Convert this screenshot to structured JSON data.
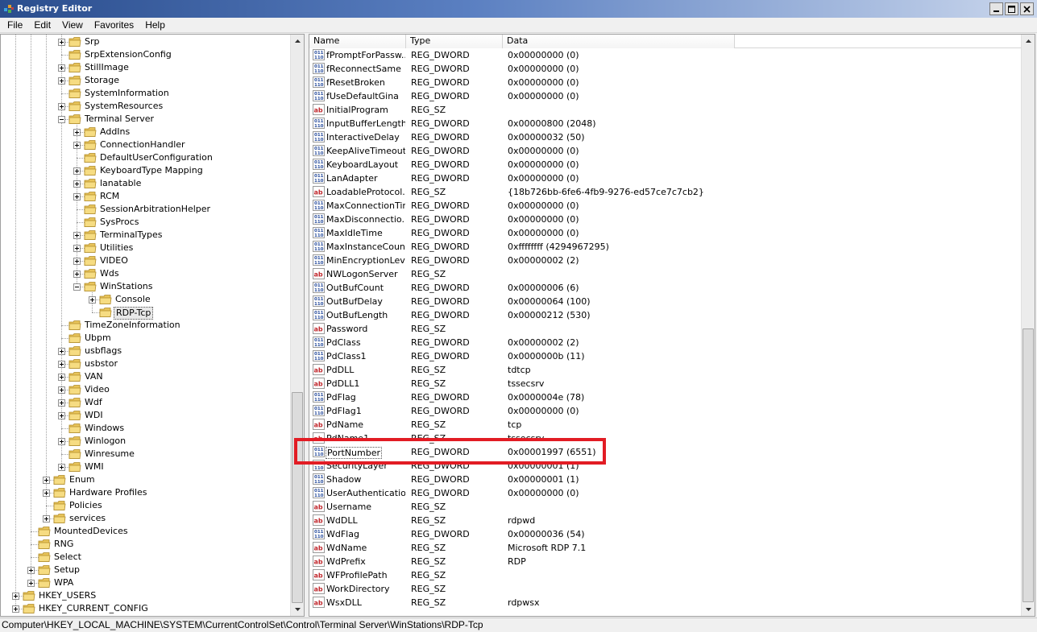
{
  "window": {
    "title": "Registry Editor"
  },
  "menu": [
    "File",
    "Edit",
    "View",
    "Favorites",
    "Help"
  ],
  "tree": [
    {
      "label": "Srp",
      "level": 3,
      "expandable": true
    },
    {
      "label": "SrpExtensionConfig",
      "level": 3,
      "expandable": false
    },
    {
      "label": "StillImage",
      "level": 3,
      "expandable": true
    },
    {
      "label": "Storage",
      "level": 3,
      "expandable": true
    },
    {
      "label": "SystemInformation",
      "level": 3,
      "expandable": false
    },
    {
      "label": "SystemResources",
      "level": 3,
      "expandable": true
    },
    {
      "label": "Terminal Server",
      "level": 3,
      "expandable": true,
      "expanded": true
    },
    {
      "label": "AddIns",
      "level": 4,
      "expandable": true
    },
    {
      "label": "ConnectionHandler",
      "level": 4,
      "expandable": true
    },
    {
      "label": "DefaultUserConfiguration",
      "level": 4,
      "expandable": false
    },
    {
      "label": "KeyboardType Mapping",
      "level": 4,
      "expandable": true
    },
    {
      "label": "lanatable",
      "level": 4,
      "expandable": true
    },
    {
      "label": "RCM",
      "level": 4,
      "expandable": true
    },
    {
      "label": "SessionArbitrationHelper",
      "level": 4,
      "expandable": false
    },
    {
      "label": "SysProcs",
      "level": 4,
      "expandable": false
    },
    {
      "label": "TerminalTypes",
      "level": 4,
      "expandable": true
    },
    {
      "label": "Utilities",
      "level": 4,
      "expandable": true
    },
    {
      "label": "VIDEO",
      "level": 4,
      "expandable": true
    },
    {
      "label": "Wds",
      "level": 4,
      "expandable": true
    },
    {
      "label": "WinStations",
      "level": 4,
      "expandable": true,
      "expanded": true
    },
    {
      "label": "Console",
      "level": 5,
      "expandable": true
    },
    {
      "label": "RDP-Tcp",
      "level": 5,
      "expandable": false,
      "selected": true
    },
    {
      "label": "TimeZoneInformation",
      "level": 3,
      "expandable": false
    },
    {
      "label": "Ubpm",
      "level": 3,
      "expandable": false
    },
    {
      "label": "usbflags",
      "level": 3,
      "expandable": true
    },
    {
      "label": "usbstor",
      "level": 3,
      "expandable": true
    },
    {
      "label": "VAN",
      "level": 3,
      "expandable": true
    },
    {
      "label": "Video",
      "level": 3,
      "expandable": true
    },
    {
      "label": "Wdf",
      "level": 3,
      "expandable": true
    },
    {
      "label": "WDI",
      "level": 3,
      "expandable": true
    },
    {
      "label": "Windows",
      "level": 3,
      "expandable": false
    },
    {
      "label": "Winlogon",
      "level": 3,
      "expandable": true
    },
    {
      "label": "Winresume",
      "level": 3,
      "expandable": false
    },
    {
      "label": "WMI",
      "level": 3,
      "expandable": true
    },
    {
      "label": "Enum",
      "level": 2,
      "expandable": true
    },
    {
      "label": "Hardware Profiles",
      "level": 2,
      "expandable": true
    },
    {
      "label": "Policies",
      "level": 2,
      "expandable": false
    },
    {
      "label": "services",
      "level": 2,
      "expandable": true
    },
    {
      "label": "MountedDevices",
      "level": 1,
      "expandable": false
    },
    {
      "label": "RNG",
      "level": 1,
      "expandable": false
    },
    {
      "label": "Select",
      "level": 1,
      "expandable": false
    },
    {
      "label": "Setup",
      "level": 1,
      "expandable": true
    },
    {
      "label": "WPA",
      "level": 1,
      "expandable": true
    },
    {
      "label": "HKEY_USERS",
      "level": 0,
      "expandable": true
    },
    {
      "label": "HKEY_CURRENT_CONFIG",
      "level": 0,
      "expandable": true
    }
  ],
  "list": {
    "columns": [
      "Name",
      "Type",
      "Data"
    ],
    "rows": [
      {
        "name": "fPromptForPassw...",
        "type": "REG_DWORD",
        "data": "0x00000000 (0)"
      },
      {
        "name": "fReconnectSame",
        "type": "REG_DWORD",
        "data": "0x00000000 (0)"
      },
      {
        "name": "fResetBroken",
        "type": "REG_DWORD",
        "data": "0x00000000 (0)"
      },
      {
        "name": "fUseDefaultGina",
        "type": "REG_DWORD",
        "data": "0x00000000 (0)"
      },
      {
        "name": "InitialProgram",
        "type": "REG_SZ",
        "data": ""
      },
      {
        "name": "InputBufferLength",
        "type": "REG_DWORD",
        "data": "0x00000800 (2048)"
      },
      {
        "name": "InteractiveDelay",
        "type": "REG_DWORD",
        "data": "0x00000032 (50)"
      },
      {
        "name": "KeepAliveTimeout",
        "type": "REG_DWORD",
        "data": "0x00000000 (0)"
      },
      {
        "name": "KeyboardLayout",
        "type": "REG_DWORD",
        "data": "0x00000000 (0)"
      },
      {
        "name": "LanAdapter",
        "type": "REG_DWORD",
        "data": "0x00000000 (0)"
      },
      {
        "name": "LoadableProtocol...",
        "type": "REG_SZ",
        "data": "{18b726bb-6fe6-4fb9-9276-ed57ce7c7cb2}"
      },
      {
        "name": "MaxConnectionTime",
        "type": "REG_DWORD",
        "data": "0x00000000 (0)"
      },
      {
        "name": "MaxDisconnectio...",
        "type": "REG_DWORD",
        "data": "0x00000000 (0)"
      },
      {
        "name": "MaxIdleTime",
        "type": "REG_DWORD",
        "data": "0x00000000 (0)"
      },
      {
        "name": "MaxInstanceCount",
        "type": "REG_DWORD",
        "data": "0xffffffff (4294967295)"
      },
      {
        "name": "MinEncryptionLevel",
        "type": "REG_DWORD",
        "data": "0x00000002 (2)"
      },
      {
        "name": "NWLogonServer",
        "type": "REG_SZ",
        "data": ""
      },
      {
        "name": "OutBufCount",
        "type": "REG_DWORD",
        "data": "0x00000006 (6)"
      },
      {
        "name": "OutBufDelay",
        "type": "REG_DWORD",
        "data": "0x00000064 (100)"
      },
      {
        "name": "OutBufLength",
        "type": "REG_DWORD",
        "data": "0x00000212 (530)"
      },
      {
        "name": "Password",
        "type": "REG_SZ",
        "data": ""
      },
      {
        "name": "PdClass",
        "type": "REG_DWORD",
        "data": "0x00000002 (2)"
      },
      {
        "name": "PdClass1",
        "type": "REG_DWORD",
        "data": "0x0000000b (11)"
      },
      {
        "name": "PdDLL",
        "type": "REG_SZ",
        "data": "tdtcp"
      },
      {
        "name": "PdDLL1",
        "type": "REG_SZ",
        "data": "tssecsrv"
      },
      {
        "name": "PdFlag",
        "type": "REG_DWORD",
        "data": "0x0000004e (78)"
      },
      {
        "name": "PdFlag1",
        "type": "REG_DWORD",
        "data": "0x00000000 (0)"
      },
      {
        "name": "PdName",
        "type": "REG_SZ",
        "data": "tcp"
      },
      {
        "name": "PdName1",
        "type": "REG_SZ",
        "data": "tssecsrv"
      },
      {
        "name": "PortNumber",
        "type": "REG_DWORD",
        "data": "0x00001997 (6551)",
        "selected": true
      },
      {
        "name": "SecurityLayer",
        "type": "REG_DWORD",
        "data": "0x00000001 (1)"
      },
      {
        "name": "Shadow",
        "type": "REG_DWORD",
        "data": "0x00000001 (1)"
      },
      {
        "name": "UserAuthentication",
        "type": "REG_DWORD",
        "data": "0x00000000 (0)"
      },
      {
        "name": "Username",
        "type": "REG_SZ",
        "data": ""
      },
      {
        "name": "WdDLL",
        "type": "REG_SZ",
        "data": "rdpwd"
      },
      {
        "name": "WdFlag",
        "type": "REG_DWORD",
        "data": "0x00000036 (54)"
      },
      {
        "name": "WdName",
        "type": "REG_SZ",
        "data": "Microsoft RDP 7.1"
      },
      {
        "name": "WdPrefix",
        "type": "REG_SZ",
        "data": "RDP"
      },
      {
        "name": "WFProfilePath",
        "type": "REG_SZ",
        "data": ""
      },
      {
        "name": "WorkDirectory",
        "type": "REG_SZ",
        "data": ""
      },
      {
        "name": "WsxDLL",
        "type": "REG_SZ",
        "data": "rdpwsx"
      }
    ]
  },
  "statusbar": {
    "path": "Computer\\HKEY_LOCAL_MACHINE\\SYSTEM\\CurrentControlSet\\Control\\Terminal Server\\WinStations\\RDP-Tcp"
  },
  "colors": {
    "highlight": "#e21c24",
    "title_start": "#2a4d8d"
  }
}
